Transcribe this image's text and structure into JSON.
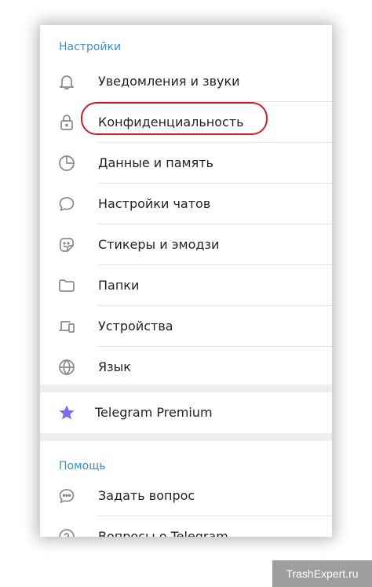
{
  "settings": {
    "section_title": "Настройки",
    "items": [
      {
        "label": "Уведомления и звуки",
        "icon": "bell-icon"
      },
      {
        "label": "Конфиденциальность",
        "icon": "lock-icon"
      },
      {
        "label": "Данные и память",
        "icon": "pie-chart-icon"
      },
      {
        "label": "Настройки чатов",
        "icon": "chat-bubble-icon"
      },
      {
        "label": "Стикеры и эмодзи",
        "icon": "sticker-icon"
      },
      {
        "label": "Папки",
        "icon": "folder-icon"
      },
      {
        "label": "Устройства",
        "icon": "devices-icon"
      },
      {
        "label": "Язык",
        "icon": "globe-icon"
      }
    ]
  },
  "premium": {
    "label": "Telegram Premium",
    "icon": "star-icon"
  },
  "help": {
    "section_title": "Помощь",
    "items": [
      {
        "label": "Задать вопрос",
        "icon": "question-chat-icon"
      },
      {
        "label": "Вопросы о Telegram",
        "icon": "help-circle-icon"
      }
    ]
  },
  "watermark": "TrashExpert.ru",
  "colors": {
    "accent": "#3a8fd0",
    "highlight": "#c8202a",
    "premium_star": "#7b6cf0"
  }
}
